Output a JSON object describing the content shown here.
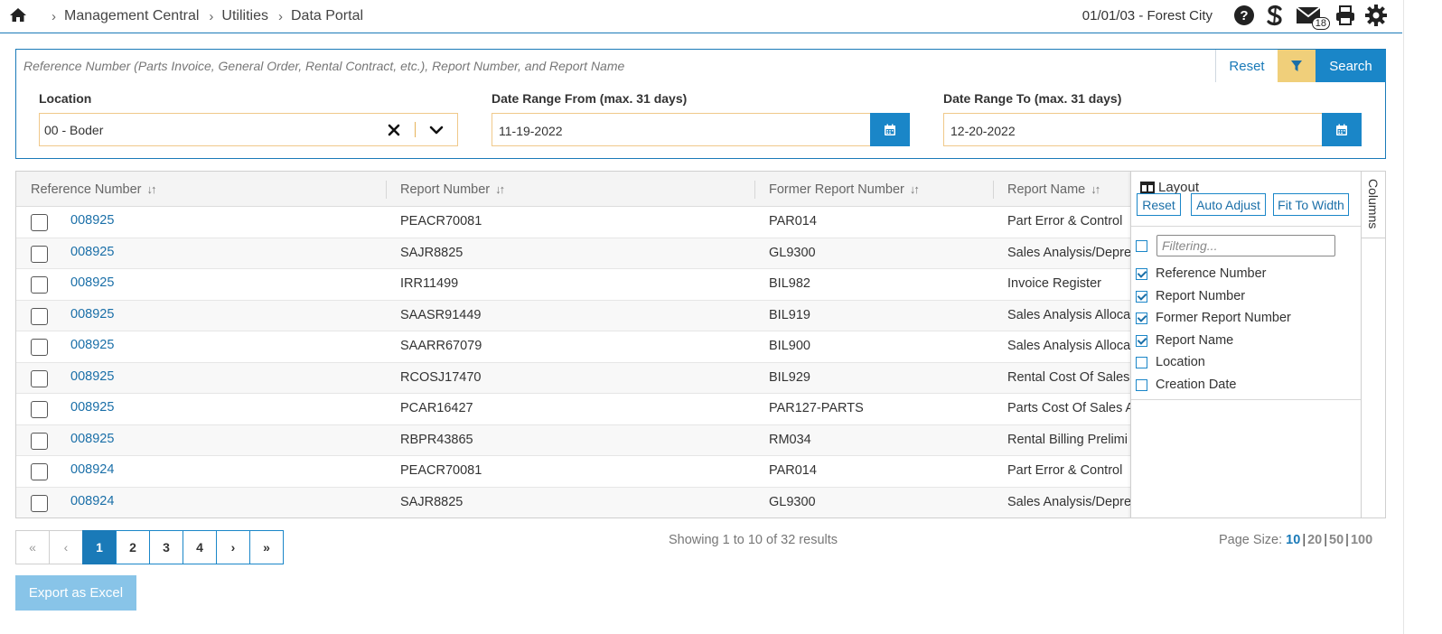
{
  "breadcrumb": [
    "Management Central",
    "Utilities",
    "Data Portal"
  ],
  "header": {
    "date_location": "01/01/03 - Forest City",
    "mail_count": "18"
  },
  "search": {
    "placeholder": "Reference Number (Parts Invoice, General Order, Rental Contract, etc.), Report Number, and Report Name",
    "reset_label": "Reset",
    "search_label": "Search"
  },
  "filters": {
    "location_label": "Location",
    "location_value": "00 - Boder",
    "date_from_label": "Date Range From (max. 31 days)",
    "date_from_value": "11-19-2022",
    "date_to_label": "Date Range To (max. 31 days)",
    "date_to_value": "12-20-2022"
  },
  "grid": {
    "columns": [
      "Reference Number",
      "Report Number",
      "Former Report Number",
      "Report Name"
    ],
    "rows": [
      [
        "008925",
        "PEACR70081",
        "PAR014",
        "Part Error & Control"
      ],
      [
        "008925",
        "SAJR8825",
        "GL9300",
        "Sales Analysis/Depre"
      ],
      [
        "008925",
        "IRR11499",
        "BIL982",
        "Invoice Register"
      ],
      [
        "008925",
        "SAASR91449",
        "BIL919",
        "Sales Analysis Alloca"
      ],
      [
        "008925",
        "SAARR67079",
        "BIL900",
        "Sales Analysis Alloca"
      ],
      [
        "008925",
        "RCOSJ17470",
        "BIL929",
        "Rental Cost Of Sales"
      ],
      [
        "008925",
        "PCAR16427",
        "PAR127-PARTS",
        "Parts Cost Of Sales A"
      ],
      [
        "008925",
        "RBPR43865",
        "RM034",
        "Rental Billing Prelimi"
      ],
      [
        "008924",
        "PEACR70081",
        "PAR014",
        "Part Error & Control"
      ],
      [
        "008924",
        "SAJR8825",
        "GL9300",
        "Sales Analysis/Depre"
      ]
    ]
  },
  "columns_panel": {
    "tab_label": "Columns",
    "layout_label": "Layout",
    "reset_label": "Reset",
    "auto_adjust_label": "Auto Adjust",
    "fit_width_label": "Fit To Width",
    "filter_placeholder": "Filtering...",
    "items": [
      {
        "label": "Reference Number",
        "checked": true
      },
      {
        "label": "Report Number",
        "checked": true
      },
      {
        "label": "Former Report Number",
        "checked": true
      },
      {
        "label": "Report Name",
        "checked": true
      },
      {
        "label": "Location",
        "checked": false
      },
      {
        "label": "Creation Date",
        "checked": false
      }
    ]
  },
  "pagination": {
    "first": "«",
    "prev": "‹",
    "next": "›",
    "last": "»",
    "pages": [
      "1",
      "2",
      "3",
      "4"
    ],
    "current": "1",
    "showing": "Showing 1 to 10 of 32 results",
    "page_size_label": "Page Size:",
    "page_sizes": [
      "10",
      "20",
      "50",
      "100"
    ]
  },
  "export_label": "Export as Excel",
  "colors": {
    "accent": "#1a86c8",
    "filter_button": "#f0cf7a",
    "link": "#1a6fa8"
  }
}
